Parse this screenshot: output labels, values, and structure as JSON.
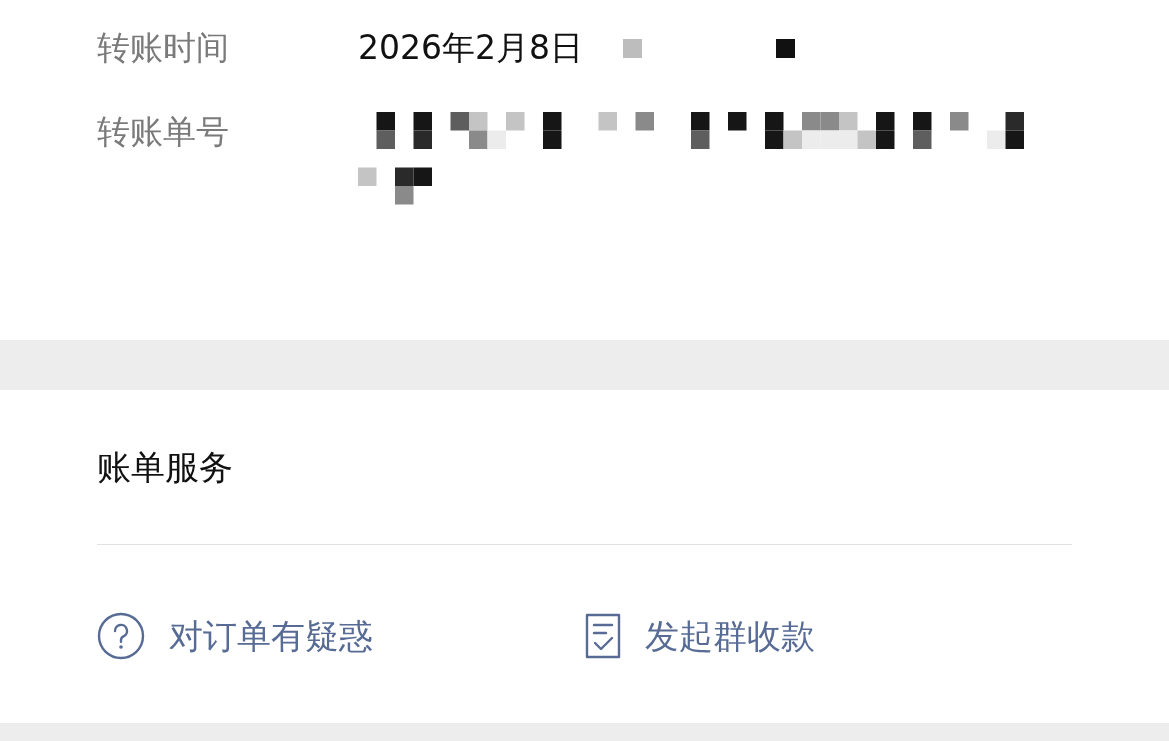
{
  "transfer_info": {
    "rows": [
      {
        "label": "转账时间",
        "value": "2026年2月8日",
        "kind": "date"
      },
      {
        "label": "转账单号",
        "kind": "hidden"
      }
    ]
  },
  "bill_services": {
    "title": "账单服务",
    "actions": [
      {
        "label": "对订单有疑惑",
        "kind": "question"
      },
      {
        "label": "发起群收款",
        "kind": "document"
      }
    ]
  }
}
